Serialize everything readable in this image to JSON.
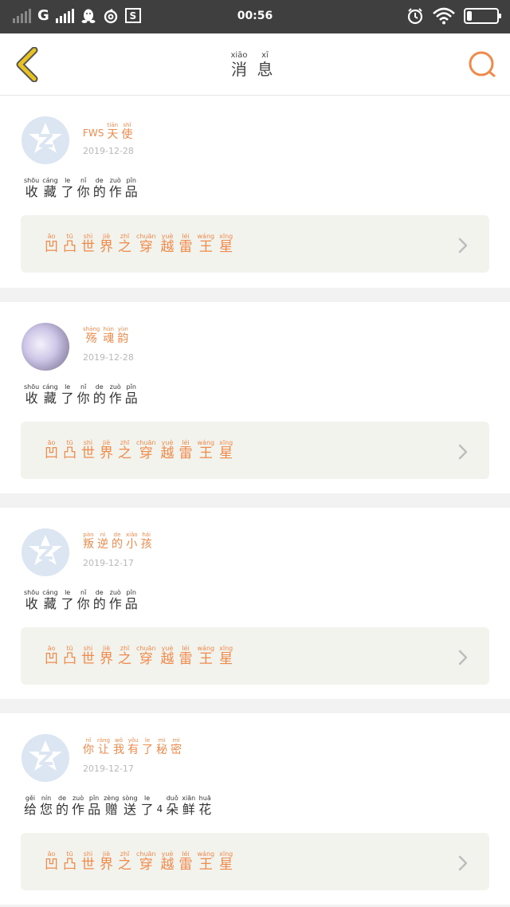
{
  "status_bar": {
    "network": "G",
    "time": "00:56",
    "icons": [
      "signal-empty-icon",
      "signal-full-icon",
      "qq-penguin-icon",
      "netease-music-icon",
      "screenshot-s-icon",
      "alarm-icon",
      "wifi-icon",
      "battery-icon"
    ]
  },
  "header": {
    "title": [
      {
        "py": "xiāo",
        "hz": "消"
      },
      {
        "py": "xī",
        "hz": "息"
      }
    ],
    "accent": "#f08a4b",
    "back_color": "#e8c220"
  },
  "messages": [
    {
      "avatar": "default",
      "user": [
        {
          "py": "",
          "hz": "FWS",
          "latin": true
        },
        {
          "py": "tiān",
          "hz": "天"
        },
        {
          "py": "shǐ",
          "hz": "使"
        }
      ],
      "date": "2019-12-28",
      "action": [
        {
          "py": "shōu",
          "hz": "收"
        },
        {
          "py": "cáng",
          "hz": "藏"
        },
        {
          "py": "le",
          "hz": "了"
        },
        {
          "py": "nǐ",
          "hz": "你"
        },
        {
          "py": "de",
          "hz": "的"
        },
        {
          "py": "zuò",
          "hz": "作"
        },
        {
          "py": "pǐn",
          "hz": "品"
        }
      ],
      "work": [
        {
          "py": "āo",
          "hz": "凹"
        },
        {
          "py": "tū",
          "hz": "凸"
        },
        {
          "py": "shì",
          "hz": "世"
        },
        {
          "py": "jiè",
          "hz": "界"
        },
        {
          "py": "zhī",
          "hz": "之"
        },
        {
          "py": "chuān",
          "hz": "穿"
        },
        {
          "py": "yuè",
          "hz": "越"
        },
        {
          "py": "léi",
          "hz": "雷"
        },
        {
          "py": "wáng",
          "hz": "王"
        },
        {
          "py": "xīng",
          "hz": "星"
        }
      ]
    },
    {
      "avatar": "photo",
      "user": [
        {
          "py": "shāng",
          "hz": "殇"
        },
        {
          "py": "hún",
          "hz": "魂"
        },
        {
          "py": "yùn",
          "hz": "韵"
        }
      ],
      "date": "2019-12-28",
      "action": [
        {
          "py": "shōu",
          "hz": "收"
        },
        {
          "py": "cáng",
          "hz": "藏"
        },
        {
          "py": "le",
          "hz": "了"
        },
        {
          "py": "nǐ",
          "hz": "你"
        },
        {
          "py": "de",
          "hz": "的"
        },
        {
          "py": "zuò",
          "hz": "作"
        },
        {
          "py": "pǐn",
          "hz": "品"
        }
      ],
      "work": [
        {
          "py": "āo",
          "hz": "凹"
        },
        {
          "py": "tū",
          "hz": "凸"
        },
        {
          "py": "shì",
          "hz": "世"
        },
        {
          "py": "jiè",
          "hz": "界"
        },
        {
          "py": "zhī",
          "hz": "之"
        },
        {
          "py": "chuān",
          "hz": "穿"
        },
        {
          "py": "yuè",
          "hz": "越"
        },
        {
          "py": "léi",
          "hz": "雷"
        },
        {
          "py": "wáng",
          "hz": "王"
        },
        {
          "py": "xīng",
          "hz": "星"
        }
      ]
    },
    {
      "avatar": "default",
      "user": [
        {
          "py": "pàn",
          "hz": "叛"
        },
        {
          "py": "nì",
          "hz": "逆"
        },
        {
          "py": "de",
          "hz": "的"
        },
        {
          "py": "xiǎo",
          "hz": "小"
        },
        {
          "py": "hái",
          "hz": "孩"
        }
      ],
      "date": "2019-12-17",
      "action": [
        {
          "py": "shōu",
          "hz": "收"
        },
        {
          "py": "cáng",
          "hz": "藏"
        },
        {
          "py": "le",
          "hz": "了"
        },
        {
          "py": "nǐ",
          "hz": "你"
        },
        {
          "py": "de",
          "hz": "的"
        },
        {
          "py": "zuò",
          "hz": "作"
        },
        {
          "py": "pǐn",
          "hz": "品"
        }
      ],
      "work": [
        {
          "py": "āo",
          "hz": "凹"
        },
        {
          "py": "tū",
          "hz": "凸"
        },
        {
          "py": "shì",
          "hz": "世"
        },
        {
          "py": "jiè",
          "hz": "界"
        },
        {
          "py": "zhī",
          "hz": "之"
        },
        {
          "py": "chuān",
          "hz": "穿"
        },
        {
          "py": "yuè",
          "hz": "越"
        },
        {
          "py": "léi",
          "hz": "雷"
        },
        {
          "py": "wáng",
          "hz": "王"
        },
        {
          "py": "xīng",
          "hz": "星"
        }
      ]
    },
    {
      "avatar": "default",
      "user": [
        {
          "py": "nǐ",
          "hz": "你"
        },
        {
          "py": "ràng",
          "hz": "让"
        },
        {
          "py": "wǒ",
          "hz": "我"
        },
        {
          "py": "yǒu",
          "hz": "有"
        },
        {
          "py": "le",
          "hz": "了"
        },
        {
          "py": "mì",
          "hz": "秘"
        },
        {
          "py": "mì",
          "hz": "密"
        }
      ],
      "date": "2019-12-17",
      "action": [
        {
          "py": "gěi",
          "hz": "给"
        },
        {
          "py": "nín",
          "hz": "您"
        },
        {
          "py": "de",
          "hz": "的"
        },
        {
          "py": "zuò",
          "hz": "作"
        },
        {
          "py": "pǐn",
          "hz": "品"
        },
        {
          "py": "zèng",
          "hz": "赠"
        },
        {
          "py": "sòng",
          "hz": "送"
        },
        {
          "py": "le",
          "hz": "了"
        },
        {
          "py": "",
          "hz": "4",
          "latin": true
        },
        {
          "py": "duǒ",
          "hz": "朵"
        },
        {
          "py": "xiān",
          "hz": "鲜"
        },
        {
          "py": "huā",
          "hz": "花"
        }
      ],
      "work": [
        {
          "py": "āo",
          "hz": "凹"
        },
        {
          "py": "tū",
          "hz": "凸"
        },
        {
          "py": "shì",
          "hz": "世"
        },
        {
          "py": "jiè",
          "hz": "界"
        },
        {
          "py": "zhī",
          "hz": "之"
        },
        {
          "py": "chuān",
          "hz": "穿"
        },
        {
          "py": "yuè",
          "hz": "越"
        },
        {
          "py": "léi",
          "hz": "雷"
        },
        {
          "py": "wáng",
          "hz": "王"
        },
        {
          "py": "xīng",
          "hz": "星"
        }
      ]
    }
  ]
}
